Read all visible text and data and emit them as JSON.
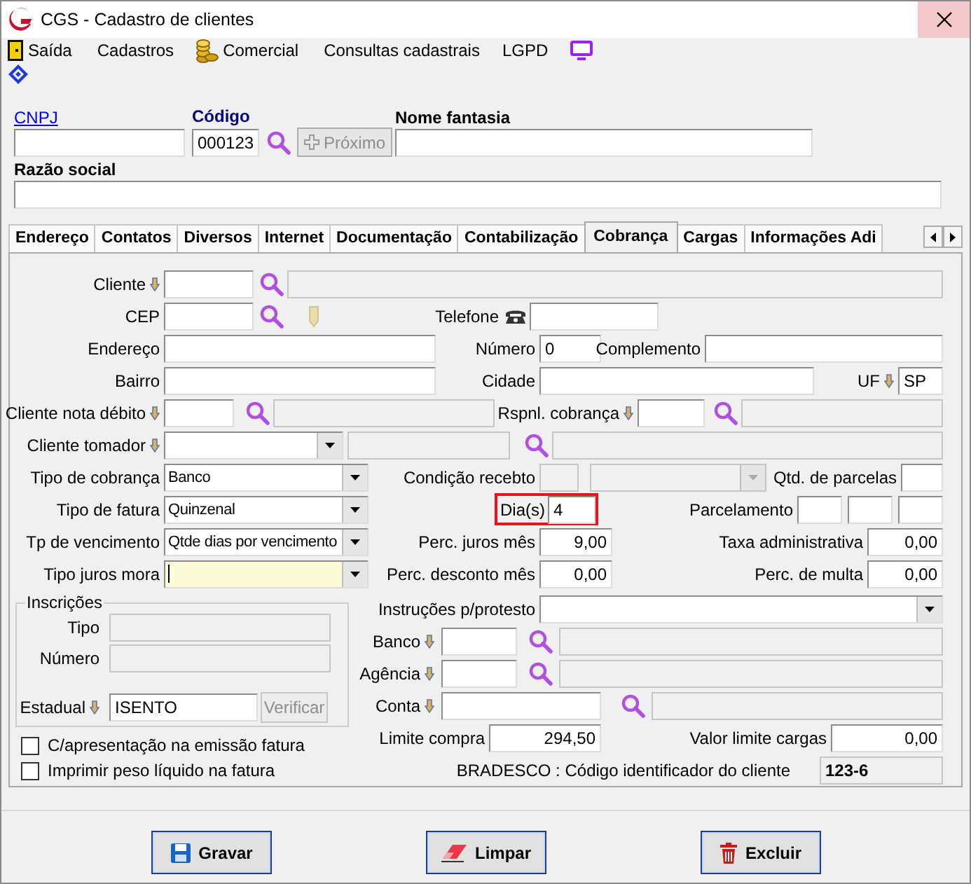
{
  "window": {
    "title": "CGS - Cadastro de clientes"
  },
  "menu": [
    {
      "label": "Saída",
      "kind": "exit"
    },
    {
      "label": "Cadastros",
      "kind": "plain"
    },
    {
      "label": "Comercial",
      "kind": "coins"
    },
    {
      "label": "Consultas cadastrais",
      "kind": "plain"
    },
    {
      "label": "LGPD",
      "kind": "plain"
    }
  ],
  "header": {
    "cnpj_label": "CNPJ",
    "codigo_label": "Código",
    "codigo_value": "000123",
    "next_button": {
      "label": "Próximo",
      "disabled": true
    },
    "nome_fantasia_label": "Nome fantasia",
    "razao_social_label": "Razão social"
  },
  "tabs": [
    {
      "label": "Endereço",
      "selected": false
    },
    {
      "label": "Contatos",
      "selected": false
    },
    {
      "label": "Diversos",
      "selected": false
    },
    {
      "label": "Internet",
      "selected": false
    },
    {
      "label": "Documentação",
      "selected": false
    },
    {
      "label": "Contabilização",
      "selected": false
    },
    {
      "label": "Cobrança",
      "selected": true
    },
    {
      "label": "Cargas",
      "selected": false
    },
    {
      "label": "Informações Adi",
      "selected": false
    }
  ],
  "cobranca": {
    "cliente": "Cliente",
    "cep": "CEP",
    "telefone": "Telefone",
    "endereco": "Endereço",
    "numero": {
      "label": "Número",
      "value": "0"
    },
    "complemento": "Complemento",
    "bairro": "Bairro",
    "cidade": "Cidade",
    "uf": {
      "label": "UF",
      "value": "SP"
    },
    "cliente_nota_debito": "Cliente nota débito",
    "rspnl_cobranca": "Rspnl. cobrança",
    "cliente_tomador": "Cliente tomador",
    "tipo_cobranca": {
      "label": "Tipo de cobrança",
      "value": "Banco"
    },
    "condicao_recebto": {
      "label": "Condição recebto",
      "disabled": true
    },
    "qtd_parcelas": "Qtd. de parcelas",
    "tipo_fatura": {
      "label": "Tipo de fatura",
      "value": "Quinzenal"
    },
    "dias": {
      "label": "Dia(s)",
      "value": "4",
      "highlighted": true
    },
    "parcelamento": "Parcelamento",
    "tp_vencimento": {
      "label": "Tp de vencimento",
      "value": "Qtde dias por vencimento"
    },
    "perc_juros": {
      "label": "Perc. juros mês",
      "value": "9,00"
    },
    "taxa_adm": {
      "label": "Taxa administrativa",
      "value": "0,00"
    },
    "tipo_juros_mora": {
      "label": "Tipo juros mora",
      "focused": true
    },
    "perc_desconto": {
      "label": "Perc. desconto mês",
      "value": "0,00"
    },
    "perc_multa": {
      "label": "Perc. de multa",
      "value": "0,00"
    },
    "inscricoes": {
      "title": "Inscrições",
      "tipo": "Tipo",
      "numero": "Número",
      "estadual": {
        "label": "Estadual",
        "value": "ISENTO"
      },
      "verificar_button": {
        "label": "Verificar",
        "disabled": true
      }
    },
    "instrucoes": "Instruções p/protesto",
    "banco": "Banco",
    "agencia": "Agência",
    "conta": "Conta",
    "limite_compra": {
      "label": "Limite compra",
      "value": "294,50"
    },
    "valor_limite_cargas": {
      "label": "Valor limite cargas",
      "value": "0,00"
    },
    "codigo_identificador": {
      "label": "BRADESCO : Código identificador do cliente",
      "value": "123-6"
    },
    "checkboxes": [
      {
        "label": "C/apresentação na emissão fatura",
        "checked": false
      },
      {
        "label": "Imprimir peso líquido na fatura",
        "checked": false
      }
    ]
  },
  "buttons": [
    {
      "label": "Gravar",
      "kind": "save"
    },
    {
      "label": "Limpar",
      "kind": "clear"
    },
    {
      "label": "Excluir",
      "kind": "delete"
    }
  ]
}
